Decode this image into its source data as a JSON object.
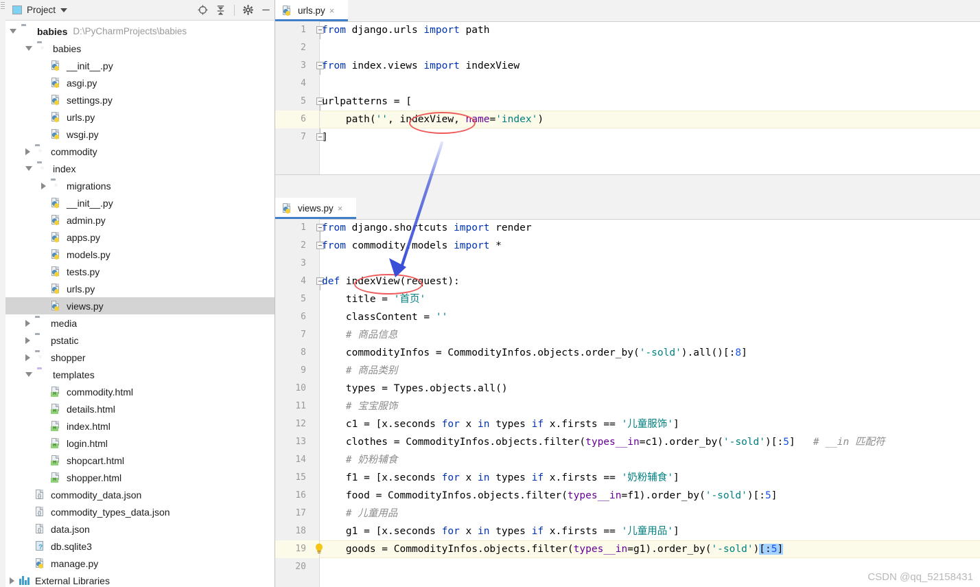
{
  "window": {
    "panel_title": "Project",
    "toolbar_icons": [
      "locate-target-icon",
      "collapse-all-icon",
      "gear-icon",
      "minimize-icon"
    ]
  },
  "project_tree": [
    {
      "depth": 0,
      "arrow": "open",
      "icon": "folder",
      "label": "babies",
      "bold": true,
      "path": "D:\\PyCharmProjects\\babies",
      "selected": false
    },
    {
      "depth": 1,
      "arrow": "open",
      "icon": "folder-src",
      "label": "babies",
      "bold": false,
      "path": "",
      "selected": false
    },
    {
      "depth": 2,
      "arrow": "none",
      "icon": "python",
      "label": "__init__.py",
      "bold": false,
      "path": "",
      "selected": false
    },
    {
      "depth": 2,
      "arrow": "none",
      "icon": "python",
      "label": "asgi.py",
      "bold": false,
      "path": "",
      "selected": false
    },
    {
      "depth": 2,
      "arrow": "none",
      "icon": "python",
      "label": "settings.py",
      "bold": false,
      "path": "",
      "selected": false
    },
    {
      "depth": 2,
      "arrow": "none",
      "icon": "python",
      "label": "urls.py",
      "bold": false,
      "path": "",
      "selected": false
    },
    {
      "depth": 2,
      "arrow": "none",
      "icon": "python",
      "label": "wsgi.py",
      "bold": false,
      "path": "",
      "selected": false
    },
    {
      "depth": 1,
      "arrow": "closed",
      "icon": "folder-src",
      "label": "commodity",
      "bold": false,
      "path": "",
      "selected": false
    },
    {
      "depth": 1,
      "arrow": "open",
      "icon": "folder-src",
      "label": "index",
      "bold": false,
      "path": "",
      "selected": false
    },
    {
      "depth": 2,
      "arrow": "closed",
      "icon": "folder-src",
      "label": "migrations",
      "bold": false,
      "path": "",
      "selected": false
    },
    {
      "depth": 2,
      "arrow": "none",
      "icon": "python",
      "label": "__init__.py",
      "bold": false,
      "path": "",
      "selected": false
    },
    {
      "depth": 2,
      "arrow": "none",
      "icon": "python",
      "label": "admin.py",
      "bold": false,
      "path": "",
      "selected": false
    },
    {
      "depth": 2,
      "arrow": "none",
      "icon": "python",
      "label": "apps.py",
      "bold": false,
      "path": "",
      "selected": false
    },
    {
      "depth": 2,
      "arrow": "none",
      "icon": "python",
      "label": "models.py",
      "bold": false,
      "path": "",
      "selected": false
    },
    {
      "depth": 2,
      "arrow": "none",
      "icon": "python",
      "label": "tests.py",
      "bold": false,
      "path": "",
      "selected": false
    },
    {
      "depth": 2,
      "arrow": "none",
      "icon": "python",
      "label": "urls.py",
      "bold": false,
      "path": "",
      "selected": false
    },
    {
      "depth": 2,
      "arrow": "none",
      "icon": "python",
      "label": "views.py",
      "bold": false,
      "path": "",
      "selected": true
    },
    {
      "depth": 1,
      "arrow": "closed",
      "icon": "folder",
      "label": "media",
      "bold": false,
      "path": "",
      "selected": false
    },
    {
      "depth": 1,
      "arrow": "closed",
      "icon": "folder",
      "label": "pstatic",
      "bold": false,
      "path": "",
      "selected": false
    },
    {
      "depth": 1,
      "arrow": "closed",
      "icon": "folder-src",
      "label": "shopper",
      "bold": false,
      "path": "",
      "selected": false
    },
    {
      "depth": 1,
      "arrow": "open",
      "icon": "folder-tpl",
      "label": "templates",
      "bold": false,
      "path": "",
      "selected": false
    },
    {
      "depth": 2,
      "arrow": "none",
      "icon": "html",
      "label": "commodity.html",
      "bold": false,
      "path": "",
      "selected": false
    },
    {
      "depth": 2,
      "arrow": "none",
      "icon": "html",
      "label": "details.html",
      "bold": false,
      "path": "",
      "selected": false
    },
    {
      "depth": 2,
      "arrow": "none",
      "icon": "html",
      "label": "index.html",
      "bold": false,
      "path": "",
      "selected": false
    },
    {
      "depth": 2,
      "arrow": "none",
      "icon": "html",
      "label": "login.html",
      "bold": false,
      "path": "",
      "selected": false
    },
    {
      "depth": 2,
      "arrow": "none",
      "icon": "html",
      "label": "shopcart.html",
      "bold": false,
      "path": "",
      "selected": false
    },
    {
      "depth": 2,
      "arrow": "none",
      "icon": "html",
      "label": "shopper.html",
      "bold": false,
      "path": "",
      "selected": false
    },
    {
      "depth": 1,
      "arrow": "none",
      "icon": "json",
      "label": "commodity_data.json",
      "bold": false,
      "path": "",
      "selected": false
    },
    {
      "depth": 1,
      "arrow": "none",
      "icon": "json",
      "label": "commodity_types_data.json",
      "bold": false,
      "path": "",
      "selected": false
    },
    {
      "depth": 1,
      "arrow": "none",
      "icon": "json",
      "label": "data.json",
      "bold": false,
      "path": "",
      "selected": false
    },
    {
      "depth": 1,
      "arrow": "none",
      "icon": "db",
      "label": "db.sqlite3",
      "bold": false,
      "path": "",
      "selected": false
    },
    {
      "depth": 1,
      "arrow": "none",
      "icon": "python",
      "label": "manage.py",
      "bold": false,
      "path": "",
      "selected": false
    },
    {
      "depth": 0,
      "arrow": "closed",
      "icon": "library",
      "label": "External Libraries",
      "bold": false,
      "path": "",
      "selected": false
    }
  ],
  "top_editor": {
    "tab": {
      "label": "urls.py",
      "close": "×",
      "icon": "python-file-icon"
    },
    "highlight_line": 6,
    "lines": [
      {
        "no": "1",
        "fold": "start",
        "tokens": [
          {
            "t": "from ",
            "c": "k"
          },
          {
            "t": "django.urls ",
            "c": "t"
          },
          {
            "t": "import ",
            "c": "k"
          },
          {
            "t": "path",
            "c": "t"
          }
        ]
      },
      {
        "no": "2",
        "fold": "none",
        "tokens": []
      },
      {
        "no": "3",
        "fold": "start",
        "tokens": [
          {
            "t": "from ",
            "c": "k"
          },
          {
            "t": "index.views ",
            "c": "t"
          },
          {
            "t": "import ",
            "c": "k"
          },
          {
            "t": "indexView",
            "c": "t"
          }
        ]
      },
      {
        "no": "4",
        "fold": "none",
        "tokens": []
      },
      {
        "no": "5",
        "fold": "start",
        "tokens": [
          {
            "t": "urlpatterns = [",
            "c": "t"
          }
        ]
      },
      {
        "no": "6",
        "fold": "none",
        "tokens": [
          {
            "t": "    path(",
            "c": "t"
          },
          {
            "t": "''",
            "c": "s"
          },
          {
            "t": ", indexView, ",
            "c": "t"
          },
          {
            "t": "name",
            "c": "kw"
          },
          {
            "t": "=",
            "c": "t"
          },
          {
            "t": "'index'",
            "c": "s"
          },
          {
            "t": ")",
            "c": "t"
          }
        ]
      },
      {
        "no": "7",
        "fold": "end",
        "tokens": [
          {
            "t": "]",
            "c": "t"
          }
        ]
      }
    ]
  },
  "bottom_editor": {
    "tab": {
      "label": "views.py",
      "close": "×",
      "icon": "python-file-icon"
    },
    "highlight_line": 19,
    "lines": [
      {
        "no": "1",
        "fold": "start",
        "tokens": [
          {
            "t": "from ",
            "c": "k"
          },
          {
            "t": "django.shortcuts ",
            "c": "t"
          },
          {
            "t": "import ",
            "c": "k"
          },
          {
            "t": "render",
            "c": "t"
          }
        ]
      },
      {
        "no": "2",
        "fold": "end",
        "tokens": [
          {
            "t": "from ",
            "c": "k"
          },
          {
            "t": "commodity.models ",
            "c": "t"
          },
          {
            "t": "import ",
            "c": "k"
          },
          {
            "t": "*",
            "c": "t"
          }
        ]
      },
      {
        "no": "3",
        "fold": "none",
        "tokens": []
      },
      {
        "no": "4",
        "fold": "start",
        "tokens": [
          {
            "t": "def ",
            "c": "k"
          },
          {
            "t": "indexView(request):",
            "c": "t"
          }
        ]
      },
      {
        "no": "5",
        "fold": "none",
        "tokens": [
          {
            "t": "    title = ",
            "c": "t"
          },
          {
            "t": "'首页'",
            "c": "s"
          }
        ]
      },
      {
        "no": "6",
        "fold": "none",
        "tokens": [
          {
            "t": "    classContent = ",
            "c": "t"
          },
          {
            "t": "''",
            "c": "s"
          }
        ]
      },
      {
        "no": "7",
        "fold": "none",
        "tokens": [
          {
            "t": "    # 商品信息",
            "c": "c"
          }
        ]
      },
      {
        "no": "8",
        "fold": "none",
        "tokens": [
          {
            "t": "    commodityInfos = CommodityInfos.objects.order_by(",
            "c": "t"
          },
          {
            "t": "'-sold'",
            "c": "s"
          },
          {
            "t": ").all()[:",
            "c": "t"
          },
          {
            "t": "8",
            "c": "n"
          },
          {
            "t": "]",
            "c": "t"
          }
        ]
      },
      {
        "no": "9",
        "fold": "none",
        "tokens": [
          {
            "t": "    # 商品类别",
            "c": "c"
          }
        ]
      },
      {
        "no": "10",
        "fold": "none",
        "tokens": [
          {
            "t": "    types = Types.objects.all()",
            "c": "t"
          }
        ]
      },
      {
        "no": "11",
        "fold": "none",
        "tokens": [
          {
            "t": "    # 宝宝服饰",
            "c": "c"
          }
        ]
      },
      {
        "no": "12",
        "fold": "none",
        "tokens": [
          {
            "t": "    c1 = [x.seconds ",
            "c": "t"
          },
          {
            "t": "for ",
            "c": "k"
          },
          {
            "t": "x ",
            "c": "t"
          },
          {
            "t": "in ",
            "c": "k"
          },
          {
            "t": "types ",
            "c": "t"
          },
          {
            "t": "if ",
            "c": "k"
          },
          {
            "t": "x.firsts == ",
            "c": "t"
          },
          {
            "t": "'儿童服饰'",
            "c": "s"
          },
          {
            "t": "]",
            "c": "t"
          }
        ]
      },
      {
        "no": "13",
        "fold": "none",
        "tokens": [
          {
            "t": "    clothes = CommodityInfos.objects.filter(",
            "c": "t"
          },
          {
            "t": "types__in",
            "c": "kw"
          },
          {
            "t": "=c1).order_by(",
            "c": "t"
          },
          {
            "t": "'-sold'",
            "c": "s"
          },
          {
            "t": ")[:",
            "c": "t"
          },
          {
            "t": "5",
            "c": "n"
          },
          {
            "t": "]   ",
            "c": "t"
          },
          {
            "t": "# __in 匹配符",
            "c": "c"
          }
        ]
      },
      {
        "no": "14",
        "fold": "none",
        "tokens": [
          {
            "t": "    # 奶粉辅食",
            "c": "c"
          }
        ]
      },
      {
        "no": "15",
        "fold": "none",
        "tokens": [
          {
            "t": "    f1 = [x.seconds ",
            "c": "t"
          },
          {
            "t": "for ",
            "c": "k"
          },
          {
            "t": "x ",
            "c": "t"
          },
          {
            "t": "in ",
            "c": "k"
          },
          {
            "t": "types ",
            "c": "t"
          },
          {
            "t": "if ",
            "c": "k"
          },
          {
            "t": "x.firsts == ",
            "c": "t"
          },
          {
            "t": "'奶粉辅食'",
            "c": "s"
          },
          {
            "t": "]",
            "c": "t"
          }
        ]
      },
      {
        "no": "16",
        "fold": "none",
        "tokens": [
          {
            "t": "    food = CommodityInfos.objects.filter(",
            "c": "t"
          },
          {
            "t": "types__in",
            "c": "kw"
          },
          {
            "t": "=f1).order_by(",
            "c": "t"
          },
          {
            "t": "'-sold'",
            "c": "s"
          },
          {
            "t": ")[:",
            "c": "t"
          },
          {
            "t": "5",
            "c": "n"
          },
          {
            "t": "]",
            "c": "t"
          }
        ]
      },
      {
        "no": "17",
        "fold": "none",
        "tokens": [
          {
            "t": "    # 儿童用品",
            "c": "c"
          }
        ]
      },
      {
        "no": "18",
        "fold": "none",
        "tokens": [
          {
            "t": "    g1 = [x.seconds ",
            "c": "t"
          },
          {
            "t": "for ",
            "c": "k"
          },
          {
            "t": "x ",
            "c": "t"
          },
          {
            "t": "in ",
            "c": "k"
          },
          {
            "t": "types ",
            "c": "t"
          },
          {
            "t": "if ",
            "c": "k"
          },
          {
            "t": "x.firsts == ",
            "c": "t"
          },
          {
            "t": "'儿童用品'",
            "c": "s"
          },
          {
            "t": "]",
            "c": "t"
          }
        ]
      },
      {
        "no": "19",
        "fold": "none",
        "bulb": true,
        "tokens": [
          {
            "t": "    goods = CommodityInfos.objects.filter(",
            "c": "t"
          },
          {
            "t": "types__in",
            "c": "kw"
          },
          {
            "t": "=g1).order_by(",
            "c": "t"
          },
          {
            "t": "'-sold'",
            "c": "s"
          },
          {
            "t": ")",
            "c": "t"
          },
          {
            "t": "[:",
            "c": "t sel"
          },
          {
            "t": "5",
            "c": "n sel"
          },
          {
            "t": "]",
            "c": "t sel"
          }
        ]
      },
      {
        "no": "20",
        "fold": "none",
        "tokens": []
      }
    ]
  },
  "annotations": {
    "ellipse_top_label": "indexView",
    "ellipse_bottom_label": "indexView",
    "arrow_color": "#3a4fd8",
    "ellipse_color": "#ef5b5b"
  },
  "watermark": "CSDN @qq_52158431"
}
